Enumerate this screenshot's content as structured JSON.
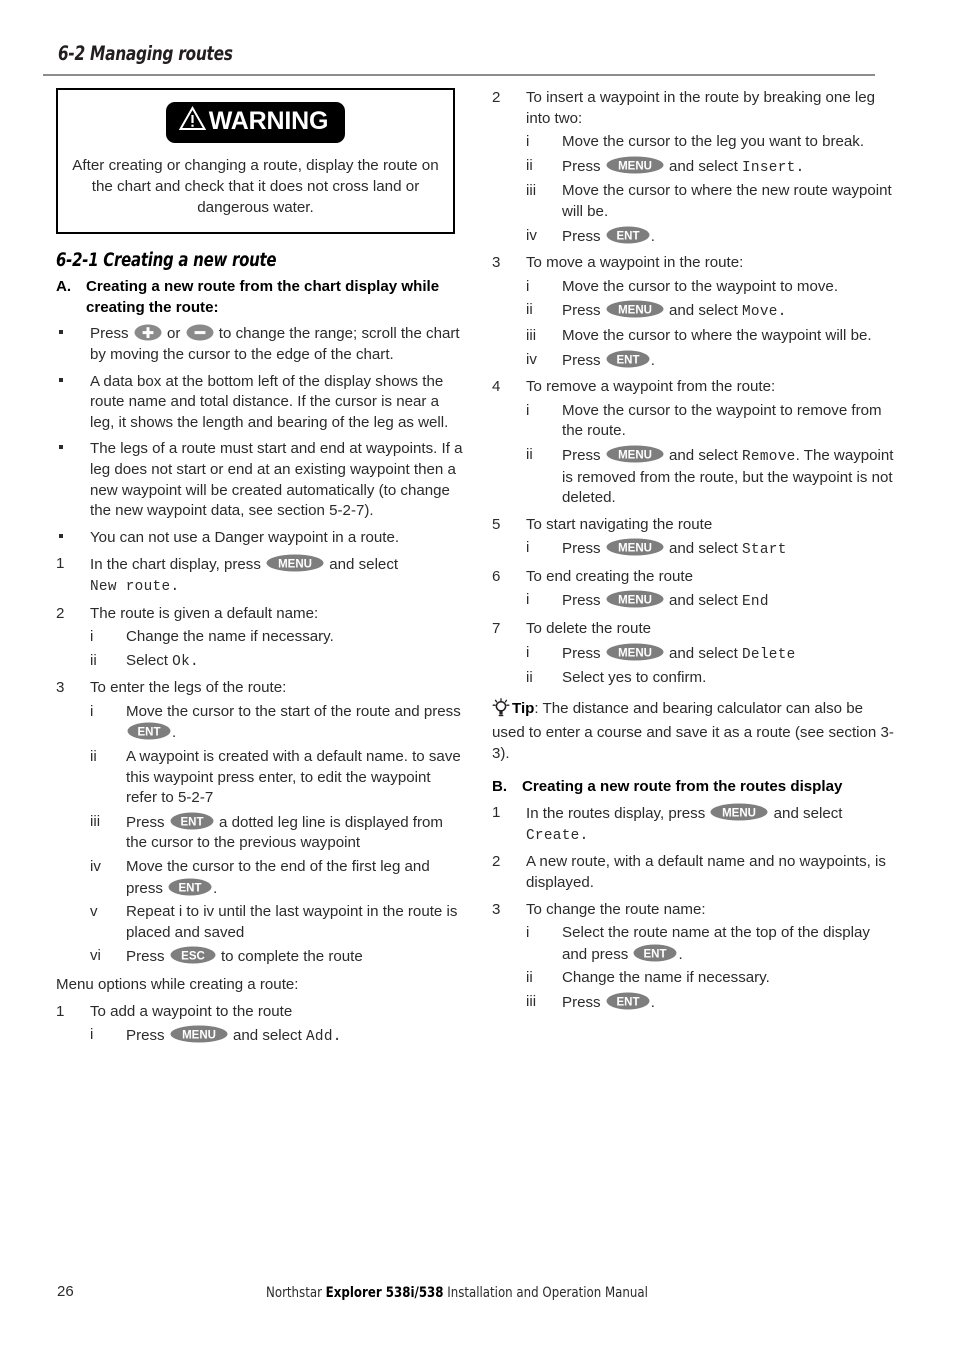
{
  "header": {
    "section_number_title": "6-2 Managing routes"
  },
  "warning": {
    "badge_label": "WARNING",
    "icon": "warning-triangle-icon",
    "text": "After creating or changing a route, display the route on the chart and check that it does not cross land or dangerous water."
  },
  "subsection": {
    "title": "6-2-1 Creating a new route"
  },
  "keys": {
    "menu": "MENU",
    "ent": "ENT",
    "esc": "ESC",
    "plus": "+",
    "minus": "-"
  },
  "left_column": {
    "part_a": {
      "marker": "A.",
      "title": "Creating a new route from the chart display while creating the route:"
    },
    "bullets": [
      {
        "pre": "Press ",
        "key1": "plus",
        "mid": " or ",
        "key2": "minus",
        "post": " to change the range; scroll the chart by moving the cursor to the edge of the chart."
      },
      {
        "text": "A data box at the bottom left of the display shows the route name and total distance. If the cursor is near a leg, it shows the length and bearing of the leg as well."
      },
      {
        "text": "The legs of a route must start and end at waypoints. If a leg does not start or end at an existing waypoint then a new waypoint will be created automatically (to change the new waypoint data, see section 5-2-7)."
      },
      {
        "text": "You can not use a Danger waypoint in a route."
      }
    ],
    "steps": [
      {
        "marker": "1",
        "pre": "In the chart display, press ",
        "key": "menu",
        "mid": " and select ",
        "mono": "New route",
        "post": "."
      },
      {
        "marker": "2",
        "text": "The route is given a default name:",
        "subs": [
          {
            "marker": "i",
            "text": "Change the name if necessary."
          },
          {
            "marker": "ii",
            "pre": "Select ",
            "mono": "Ok",
            "post": "."
          }
        ]
      },
      {
        "marker": "3",
        "text": "To enter the legs of the route:",
        "subs": [
          {
            "marker": "i",
            "pre": "Move the cursor to the start of the route and press ",
            "key": "ent",
            "post": "."
          },
          {
            "marker": "ii",
            "text": "A waypoint is created with a default name. to save this waypoint press enter, to edit the waypoint refer to 5-2-7"
          },
          {
            "marker": "iii",
            "pre": "Press ",
            "key": "ent",
            "post": " a dotted leg line is displayed from the cursor to the previous waypoint"
          },
          {
            "marker": "iv",
            "pre": "Move the cursor to the end of the first leg and press ",
            "key": "ent",
            "post": "."
          },
          {
            "marker": "v",
            "text": "Repeat i to iv until the last waypoint in the route is placed and saved"
          },
          {
            "marker": "vi",
            "pre": "Press ",
            "key": "esc",
            "post": " to complete the route"
          }
        ]
      }
    ],
    "menu_options_intro": "Menu options while creating a route:",
    "menu_step_1": {
      "marker": "1",
      "text": "To add a waypoint to the route",
      "sub": {
        "marker": "i",
        "pre": "Press ",
        "key": "menu",
        "mid": " and select ",
        "mono": "Add",
        "post": "."
      }
    }
  },
  "right_column": {
    "steps": [
      {
        "marker": "2",
        "text": "To insert a waypoint in the route by breaking one leg into two:",
        "subs": [
          {
            "marker": "i",
            "text": "Move the cursor to the leg you want to break."
          },
          {
            "marker": "ii",
            "pre": "Press ",
            "key": "menu",
            "mid": " and select ",
            "mono": "Insert",
            "post": "."
          },
          {
            "marker": "iii",
            "text": "Move the cursor to where the new route waypoint will be."
          },
          {
            "marker": "iv",
            "pre": "Press ",
            "key": "ent",
            "post": "."
          }
        ]
      },
      {
        "marker": "3",
        "text": "To move a waypoint in the route:",
        "subs": [
          {
            "marker": "i",
            "text": "Move the cursor to the waypoint to move."
          },
          {
            "marker": "ii",
            "pre": "Press ",
            "key": "menu",
            "mid": " and select ",
            "mono": "Move",
            "post": "."
          },
          {
            "marker": "iii",
            "text": "Move the cursor to where the waypoint will be."
          },
          {
            "marker": "iv",
            "pre": "Press ",
            "key": "ent",
            "post": "."
          }
        ]
      },
      {
        "marker": "4",
        "text": "To remove a waypoint from the route:",
        "subs": [
          {
            "marker": "i",
            "text": "Move the cursor to the waypoint to remove from the route."
          },
          {
            "marker": "ii",
            "pre": "Press ",
            "key": "menu",
            "mid": " and select ",
            "mono": "Remove",
            "post": ". The waypoint is removed from the route, but the waypoint is not deleted."
          }
        ]
      },
      {
        "marker": "5",
        "text": "To start navigating the route",
        "subs": [
          {
            "marker": "i",
            "pre": "Press ",
            "key": "menu",
            "mid": " and select ",
            "mono": "Start",
            "post": ""
          }
        ]
      },
      {
        "marker": "6",
        "text": "To end creating the route",
        "subs": [
          {
            "marker": "i",
            "pre": "Press ",
            "key": "menu",
            "mid": " and select ",
            "mono": "End",
            "post": ""
          }
        ]
      },
      {
        "marker": "7",
        "text": "To delete the route",
        "subs": [
          {
            "marker": "i",
            "pre": "Press ",
            "key": "menu",
            "mid": " and select ",
            "mono": "Delete",
            "post": ""
          },
          {
            "marker": "ii",
            "text": "Select yes to confirm."
          }
        ]
      }
    ],
    "tip": {
      "icon": "lightbulb-icon",
      "label": "Tip",
      "text": ": The distance and bearing calculator can also be used to enter a course and save it as a route (see section 3-3)."
    },
    "part_b": {
      "marker": "B.",
      "title": "Creating a new route from the routes display"
    },
    "b_steps": [
      {
        "marker": "1",
        "pre": "In the routes display, press ",
        "key": "menu",
        "mid": " and select ",
        "mono": "Create",
        "post": "."
      },
      {
        "marker": "2",
        "text": "A new route, with a default name and no waypoints, is displayed."
      },
      {
        "marker": "3",
        "text": "To change the route name:",
        "subs": [
          {
            "marker": "i",
            "pre": "Select the route name at the top of the display and press ",
            "key": "ent",
            "post": "."
          },
          {
            "marker": "ii",
            "text": "Change the name if necessary."
          },
          {
            "marker": "iii",
            "pre": "Press ",
            "key": "ent",
            "post": "."
          }
        ]
      }
    ]
  },
  "footer": {
    "page_number": "26",
    "brand": "Northstar ",
    "model": "Explorer 538i/538",
    "manual": " Installation and Operation Manual"
  },
  "colors": {
    "text": "#2b2b2b",
    "heading": "#000000",
    "rule": "#8d8d8d",
    "keycap": "#8a8a8a"
  }
}
